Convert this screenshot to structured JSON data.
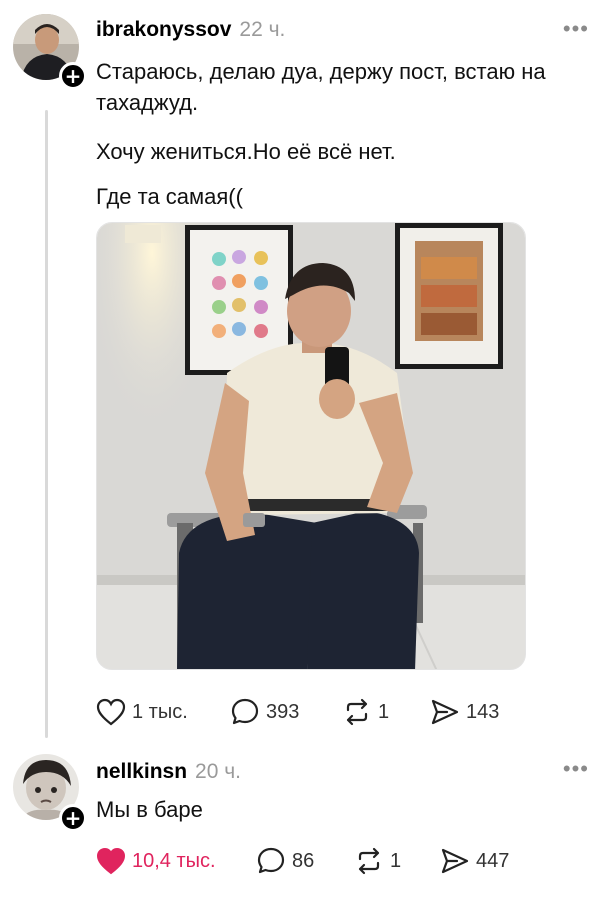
{
  "posts": [
    {
      "username": "ibrakonyssov",
      "time": "22 ч.",
      "lines": [
        "Стараюсь, делаю дуа, держу пост, встаю на тахаджуд.",
        "Хочу жениться.Но её всё нет.",
        "Где та самая(("
      ],
      "likes": "1 тыс.",
      "comments": "393",
      "reposts": "1",
      "shares": "143",
      "liked": false
    },
    {
      "username": "nellkinsn",
      "time": "20 ч.",
      "lines": [
        "Мы в баре"
      ],
      "likes": "10,4 тыс.",
      "comments": "86",
      "reposts": "1",
      "shares": "447",
      "liked": true
    }
  ],
  "colors": {
    "like_active": "#e0245e",
    "meta_gray": "#9a9a9a",
    "thread_line": "#d9d9d9"
  },
  "icons": [
    "heart-icon",
    "comment-icon",
    "repost-icon",
    "share-icon",
    "more-icon",
    "follow-plus-icon"
  ]
}
